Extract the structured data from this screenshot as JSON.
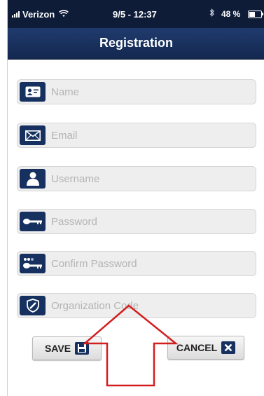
{
  "status_bar": {
    "carrier": "Verizon",
    "time": "9/5 - 12:37",
    "battery": "48 %"
  },
  "nav": {
    "title": "Registration"
  },
  "fields": [
    {
      "placeholder": "Name",
      "icon": "contact-card-icon",
      "value": ""
    },
    {
      "placeholder": "Email",
      "icon": "envelope-icon",
      "value": ""
    },
    {
      "placeholder": "Username",
      "icon": "person-icon",
      "value": ""
    },
    {
      "placeholder": "Password",
      "icon": "key-icon",
      "value": ""
    },
    {
      "placeholder": "Confirm Password",
      "icon": "key-dots-icon",
      "value": ""
    },
    {
      "placeholder": "Organization Code",
      "icon": "shield-icon",
      "value": ""
    }
  ],
  "buttons": {
    "save": {
      "label": "SAVE",
      "icon": "floppy-disk-icon"
    },
    "cancel": {
      "label": "CANCEL",
      "icon": "close-x-icon"
    }
  },
  "colors": {
    "nav_bg": "#1f3b6e",
    "icon_box": "#16305f",
    "annotation": "#d11f1f"
  }
}
